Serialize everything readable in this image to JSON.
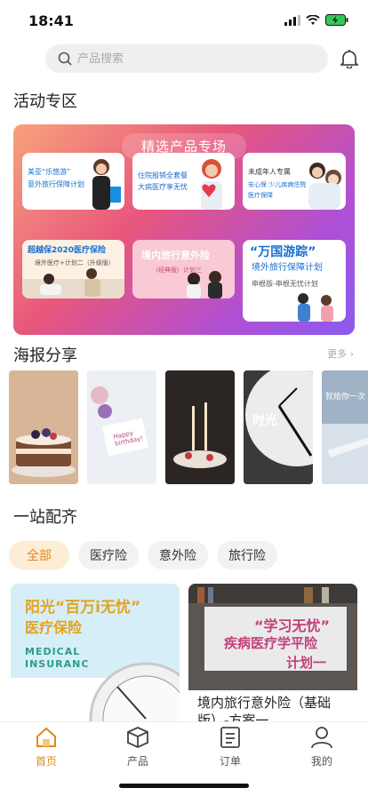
{
  "status": {
    "time": "18:41"
  },
  "search": {
    "placeholder": "产品搜索"
  },
  "sections": {
    "activities": "活动专区",
    "posters": "海报分享",
    "posters_more": "更多",
    "one_stop": "一站配齐"
  },
  "banner": {
    "title": "精选产品专场",
    "cards": [
      {
        "title": "美亚“乐悠游”",
        "subtitle": "意外旅行保障计划"
      },
      {
        "title": "住院报销全套餐",
        "subtitle": "大病医疗享无忧"
      },
      {
        "title": "未成年人专属",
        "subtitle": "安心保 少儿疾病住院医疗保障"
      },
      {
        "title": "超越保2020医疗保险",
        "subtitle": "境外医疗+计划二（升级版）"
      },
      {
        "title": "境内旅行意外险",
        "subtitle": "（经典版）计划三"
      },
      {
        "title": "“万国游踪”",
        "subtitle": "境外旅行保障计划",
        "extra": "申根版-申根无忧计划"
      }
    ]
  },
  "posters": [
    {
      "name": "birthday-cake"
    },
    {
      "name": "happy-birthday-card",
      "text": "Happy birthday!"
    },
    {
      "name": "cake-candles"
    },
    {
      "name": "clock",
      "text": "时光"
    },
    {
      "name": "airplane",
      "text": "就给你一次"
    }
  ],
  "chips": [
    {
      "label": "全部",
      "active": true
    },
    {
      "label": "医疗险",
      "active": false
    },
    {
      "label": "意外险",
      "active": false
    },
    {
      "label": "旅行险",
      "active": false
    }
  ],
  "products": [
    {
      "headline": "阳光“百万i无忧”",
      "sub": "医疗保险",
      "english": "MEDICAL INSURANC"
    },
    {
      "headline": "“学习无忧”",
      "sub": "疾病医疗学平险",
      "sub2": "计划一",
      "caption": "境内旅行意外险（基础版）-方案一"
    }
  ],
  "tabbar": [
    {
      "label": "首页",
      "icon": "home-icon",
      "active": true
    },
    {
      "label": "产品",
      "icon": "product-box-icon",
      "active": false
    },
    {
      "label": "订单",
      "icon": "order-list-icon",
      "active": false
    },
    {
      "label": "我的",
      "icon": "profile-icon",
      "active": false
    }
  ],
  "colors": {
    "accent": "#e08a18",
    "banner_pink": "#e8567d",
    "banner_purple": "#8a5cf0"
  }
}
